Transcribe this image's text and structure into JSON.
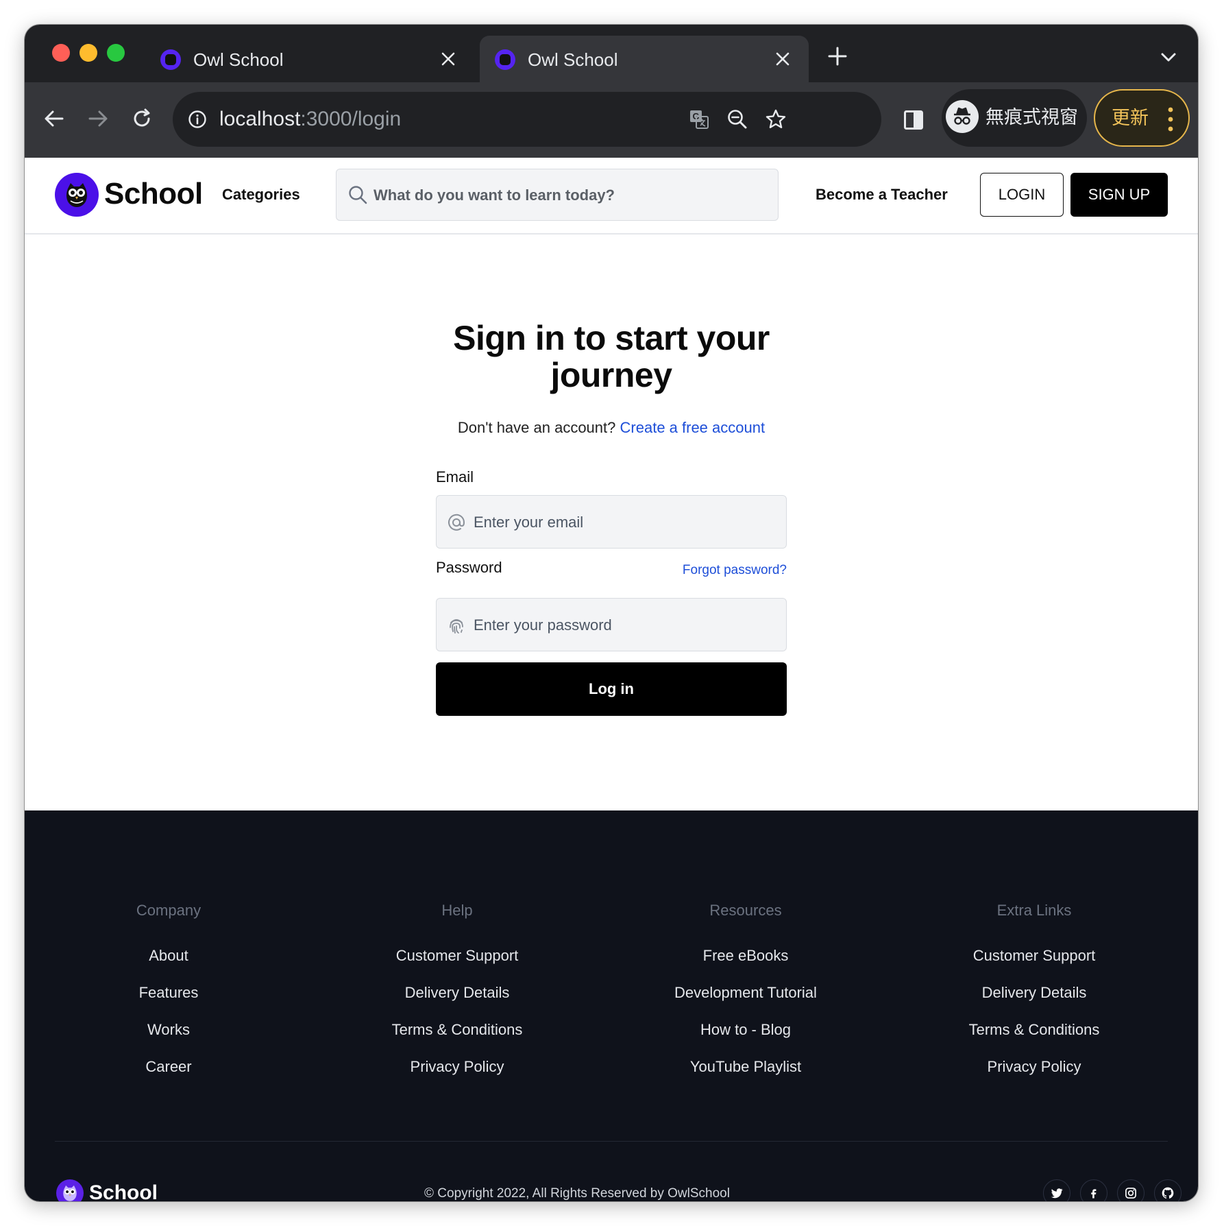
{
  "browser": {
    "tabs": [
      {
        "title": "Owl School"
      },
      {
        "title": "Owl School"
      }
    ],
    "url_host": "localhost",
    "url_path": ":3000/login",
    "incognito_label": "無痕式視窗",
    "update_label": "更新"
  },
  "header": {
    "logo_text": "School",
    "categories": "Categories",
    "search_placeholder": "What do you want to learn today?",
    "become_teacher": "Become a Teacher",
    "login": "LOGIN",
    "signup": "SIGN UP"
  },
  "login_form": {
    "heading_line1": "Sign in to start your",
    "heading_line2": "journey",
    "no_account": "Don't have an account?",
    "create_account": "Create a free account",
    "email_label": "Email",
    "email_placeholder": "Enter your email",
    "password_label": "Password",
    "forgot_password": "Forgot password?",
    "password_placeholder": "Enter your password",
    "submit": "Log in"
  },
  "footer": {
    "columns": [
      {
        "title": "Company",
        "links": [
          "About",
          "Features",
          "Works",
          "Career"
        ]
      },
      {
        "title": "Help",
        "links": [
          "Customer Support",
          "Delivery Details",
          "Terms & Conditions",
          "Privacy Policy"
        ]
      },
      {
        "title": "Resources",
        "links": [
          "Free eBooks",
          "Development Tutorial",
          "How to - Blog",
          "YouTube Playlist"
        ]
      },
      {
        "title": "Extra Links",
        "links": [
          "Customer Support",
          "Delivery Details",
          "Terms & Conditions",
          "Privacy Policy"
        ]
      }
    ],
    "logo_text": "School",
    "copyright": "© Copyright 2022, All Rights Reserved by OwlSchool",
    "social_icons": [
      "twitter-icon",
      "facebook-icon",
      "instagram-icon",
      "github-icon"
    ]
  },
  "colors": {
    "brand_purple": "#4b10e8",
    "link_blue": "#1d4ed8",
    "footer_bg": "#0f121b",
    "primary_button": "#000000"
  }
}
